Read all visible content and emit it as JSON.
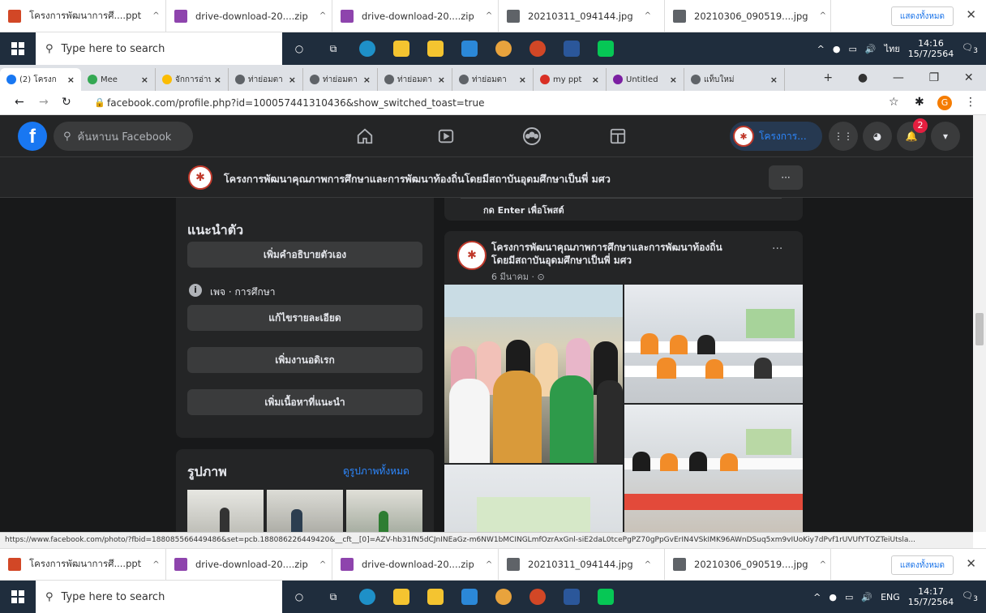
{
  "downloads": [
    {
      "name": "โครงการพัฒนาการศึ....ppt",
      "color": "#d24726"
    },
    {
      "name": "drive-download-20....zip",
      "color": "#8e44ad"
    },
    {
      "name": "drive-download-20....zip",
      "color": "#8e44ad"
    },
    {
      "name": "20210311_094144.jpg",
      "color": "#5f6368"
    },
    {
      "name": "20210306_090519....jpg",
      "color": "#5f6368"
    }
  ],
  "downloads_bottom": [
    {
      "name": "โครงการพัฒนาการศึ....ppt",
      "color": "#d24726"
    },
    {
      "name": "drive-download-20....zip",
      "color": "#8e44ad"
    },
    {
      "name": "drive-download-20....zip",
      "color": "#8e44ad"
    },
    {
      "name": "20210311_094144.jpg",
      "color": "#5f6368"
    },
    {
      "name": "20210306_090519....jpg",
      "color": "#5f6368"
    }
  ],
  "show_all": "แสดงทั้งหมด",
  "taskbar": {
    "search_placeholder": "Type here to search",
    "lang_top": "ไทย",
    "time_top": "14:16",
    "date_top": "15/7/2564",
    "lang_bottom": "ENG",
    "time_bottom": "14:17",
    "date_bottom": "15/7/2564",
    "notif": "3"
  },
  "tabs": [
    {
      "label": "(2) โครงก",
      "active": true
    },
    {
      "label": "Mee",
      "active": false
    },
    {
      "label": "จักการอ่าน",
      "active": false
    },
    {
      "label": "ท่าย่อมตา",
      "active": false
    },
    {
      "label": "ท่าย่อมตา",
      "active": false
    },
    {
      "label": "ท่าย่อมตา",
      "active": false
    },
    {
      "label": "ท่าย่อมตา",
      "active": false
    },
    {
      "label": "my ppt",
      "active": false
    },
    {
      "label": "Untitled",
      "active": false
    },
    {
      "label": "แท็บใหม่",
      "active": false
    }
  ],
  "url": "facebook.com/profile.php?id=100057441310436&show_switched_toast=true",
  "profile_initial": "G",
  "fb": {
    "search_placeholder": "ค้นหาบน Facebook",
    "profile_short": "โครงการ...",
    "notif_count": "2",
    "page_name": "โครงการพัฒนาคุณภาพการศึกษาและการพัฒนาท้องถิ่นโดยมีสถาบันอุดมศึกษาเป็นพี่ มศว",
    "more": "···",
    "intro_title": "แนะนำตัว",
    "add_bio": "เพิ่มคำอธิบายตัวเอง",
    "page_type": "เพจ · การศึกษา",
    "edit_details": "แก้ไขรายละเอียด",
    "add_hobbies": "เพิ่มงานอดิเรก",
    "add_featured": "เพิ่มเนื้อหาที่แนะนำ",
    "photos_title": "รูปภาพ",
    "see_all_photos": "ดูรูปภาพทั้งหมด",
    "enter_to_post": "กด Enter เพื่อโพสต์",
    "post_author_line1": "โครงการพัฒนาคุณภาพการศึกษาและการพัฒนาท้องถิ่น",
    "post_author_line2": "โดยมีสถาบันอุดมศึกษาเป็นพี่ มศว",
    "post_date": "6 มีนาคม · ⊙"
  },
  "status_url": "https://www.facebook.com/photo/?fbid=188085566449486&set=pcb.188086226449420&__cft__[0]=AZV-hb31fN5dCJnINEaGz-m6NW1bMCINGLmfOzrAxGnl-siE2daL0tcePgPZ70gPpGvErIN4VSkIMK96AWnDSuq5xm9vIUoKiy7dPvf1rUVUfYTOZTeiUtsla..."
}
